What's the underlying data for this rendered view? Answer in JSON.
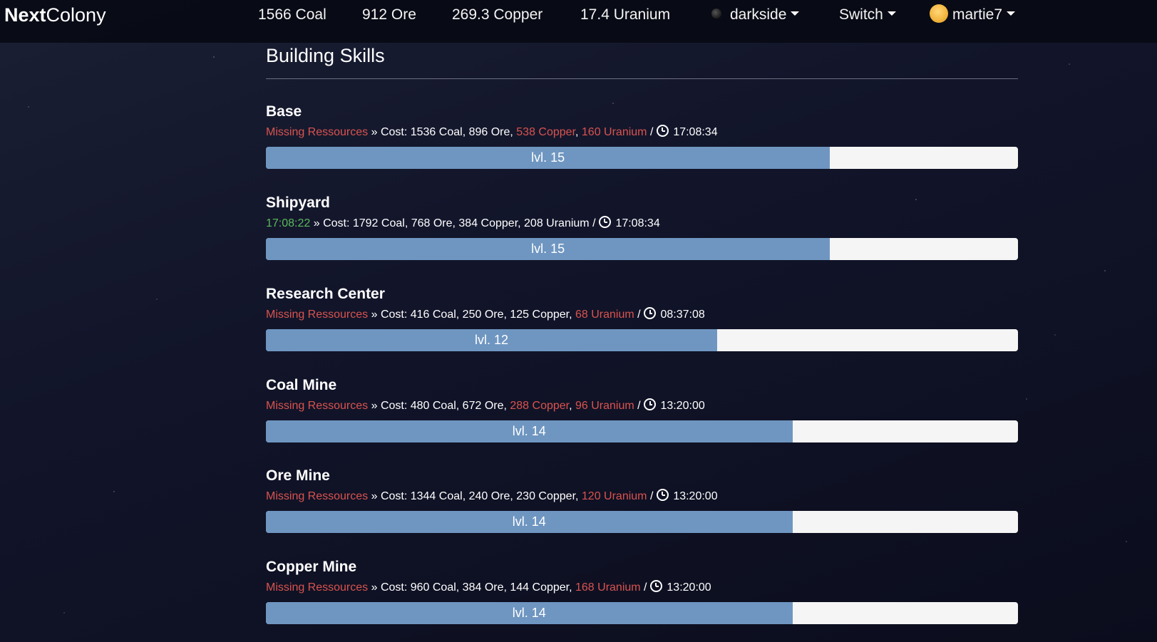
{
  "navbar": {
    "brand_bold": "Next",
    "brand_rest": "Colony",
    "resources": {
      "coal": "1566 Coal",
      "ore": "912 Ore",
      "copper": "269.3 Copper",
      "uranium": "17.4 Uranium"
    },
    "planet": "darkside",
    "switch": "Switch",
    "user": "martie7"
  },
  "page": {
    "title": "Building Skills"
  },
  "colors": {
    "missing": "#d9534f",
    "ready": "#5cb85c",
    "bar": "#6f96c1"
  },
  "skills": [
    {
      "name": "Base",
      "status": "Missing Ressources",
      "sep": " » Cost: ",
      "coal": "1536 Coal",
      "ore": "896 Ore",
      "copper": "538 Copper",
      "uranium": "160 Uranium",
      "time": "17:08:34",
      "level": "lvl. 15",
      "progress": 0.75
    },
    {
      "name": "Shipyard",
      "status": "17:08:22",
      "sep": " » Cost: ",
      "coal": "1792 Coal",
      "ore": "768 Ore",
      "copper": "384 Copper",
      "uranium": "208 Uranium",
      "time": "17:08:34",
      "level": "lvl. 15",
      "progress": 0.75
    },
    {
      "name": "Research Center",
      "status": "Missing Ressources",
      "sep": " » Cost: ",
      "coal": "416 Coal",
      "ore": "250 Ore",
      "copper": "125 Copper",
      "uranium": "68 Uranium",
      "time": "08:37:08",
      "level": "lvl. 12",
      "progress": 0.6
    },
    {
      "name": "Coal Mine",
      "status": "Missing Ressources",
      "sep": " » Cost: ",
      "coal": "480 Coal",
      "ore": "672 Ore",
      "copper": "288 Copper",
      "uranium": "96 Uranium",
      "time": "13:20:00",
      "level": "lvl. 14",
      "progress": 0.7
    },
    {
      "name": "Ore Mine",
      "status": "Missing Ressources",
      "sep": " » Cost: ",
      "coal": "1344 Coal",
      "ore": "240 Ore",
      "copper": "230 Copper",
      "uranium": "120 Uranium",
      "time": "13:20:00",
      "level": "lvl. 14",
      "progress": 0.7
    },
    {
      "name": "Copper Mine",
      "status": "Missing Ressources",
      "sep": " » Cost: ",
      "coal": "960 Coal",
      "ore": "384 Ore",
      "copper": "144 Copper",
      "uranium": "168 Uranium",
      "time": "13:20:00",
      "level": "lvl. 14",
      "progress": 0.7
    }
  ]
}
